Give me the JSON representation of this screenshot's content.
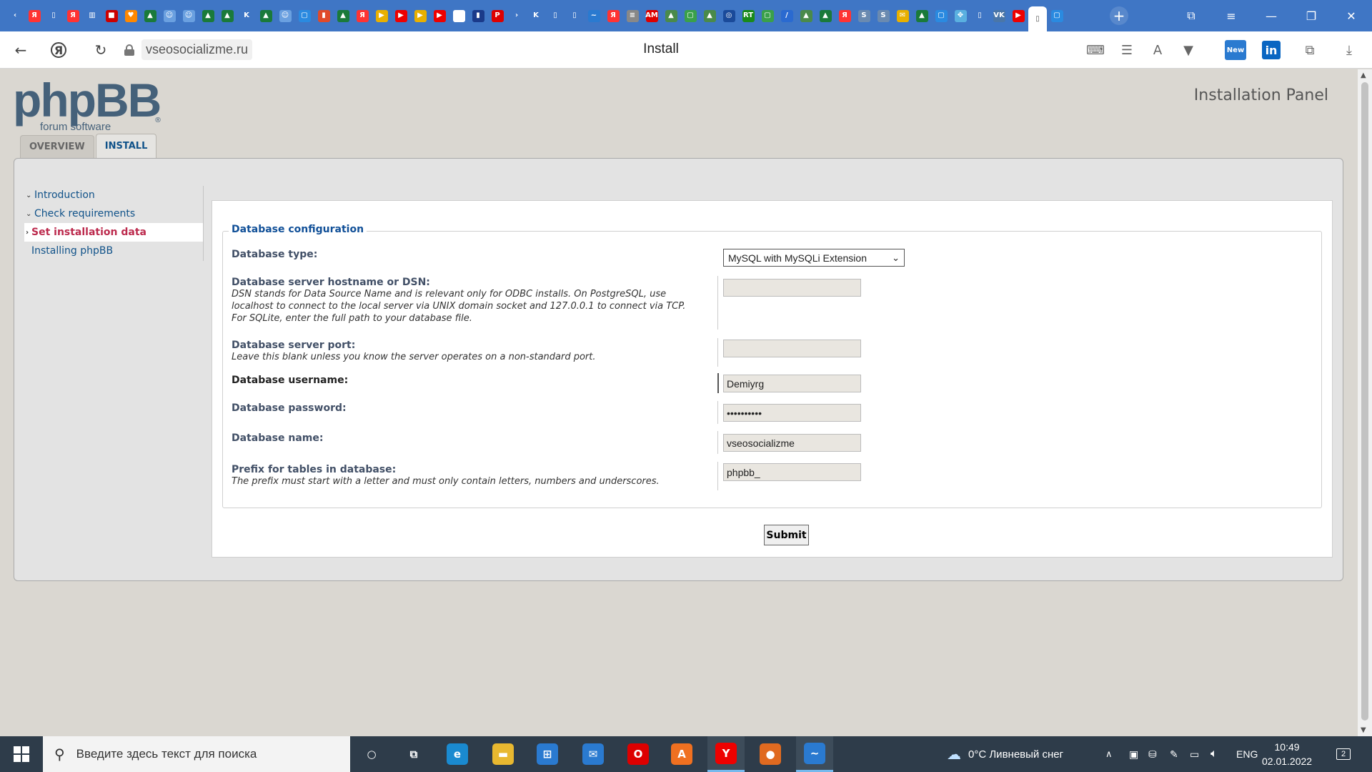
{
  "browser": {
    "tab_icons": [
      {
        "name": "tab-favicon-back",
        "glyph": "‹",
        "bg": "transparent"
      },
      {
        "name": "tab-favicon-yandex",
        "glyph": "Я",
        "bg": "#f33"
      },
      {
        "name": "tab-favicon-doc",
        "glyph": "▯",
        "bg": "transparent"
      },
      {
        "name": "tab-favicon-yandex",
        "glyph": "Я",
        "bg": "#f33"
      },
      {
        "name": "tab-favicon-chart",
        "glyph": "▥",
        "bg": "transparent"
      },
      {
        "name": "tab-favicon-bookmark",
        "glyph": "■",
        "bg": "#c00"
      },
      {
        "name": "tab-favicon-heart",
        "glyph": "♥",
        "bg": "#f80"
      },
      {
        "name": "tab-favicon-green",
        "glyph": "▲",
        "bg": "#1a7a3a"
      },
      {
        "name": "tab-favicon-people",
        "glyph": "☺",
        "bg": "#6aa0e0"
      },
      {
        "name": "tab-favicon-people",
        "glyph": "☺",
        "bg": "#6aa0e0"
      },
      {
        "name": "tab-favicon-green",
        "glyph": "▲",
        "bg": "#1a7a3a"
      },
      {
        "name": "tab-favicon-green",
        "glyph": "▲",
        "bg": "#1a7a3a"
      },
      {
        "name": "tab-favicon-k",
        "glyph": "K",
        "bg": "transparent"
      },
      {
        "name": "tab-favicon-green",
        "glyph": "▲",
        "bg": "#1a7a3a"
      },
      {
        "name": "tab-favicon-people",
        "glyph": "☺",
        "bg": "#6aa0e0"
      },
      {
        "name": "tab-favicon-chat",
        "glyph": "▢",
        "bg": "#2a8ae0"
      },
      {
        "name": "tab-favicon-bars",
        "glyph": "▮",
        "bg": "#e04a2a"
      },
      {
        "name": "tab-favicon-green",
        "glyph": "▲",
        "bg": "#1a7a3a"
      },
      {
        "name": "tab-favicon-yandex",
        "glyph": "Я",
        "bg": "#f33"
      },
      {
        "name": "tab-favicon-play",
        "glyph": "▶",
        "bg": "#e8b000"
      },
      {
        "name": "tab-favicon-youtube",
        "glyph": "▶",
        "bg": "#e00"
      },
      {
        "name": "tab-favicon-play",
        "glyph": "▶",
        "bg": "#e8b000"
      },
      {
        "name": "tab-favicon-youtube",
        "glyph": "▶",
        "bg": "#e00"
      },
      {
        "name": "tab-favicon-wiki",
        "glyph": "W",
        "bg": "#fff"
      },
      {
        "name": "tab-favicon-book",
        "glyph": "▮",
        "bg": "#1a3a8a"
      },
      {
        "name": "tab-favicon-pdf",
        "glyph": "P",
        "bg": "#d00"
      },
      {
        "name": "tab-favicon-arrow",
        "glyph": "›",
        "bg": "transparent"
      },
      {
        "name": "tab-favicon-k",
        "glyph": "K",
        "bg": "transparent"
      },
      {
        "name": "tab-favicon-doc",
        "glyph": "▯",
        "bg": "transparent"
      },
      {
        "name": "tab-favicon-doc",
        "glyph": "▯",
        "bg": "transparent"
      },
      {
        "name": "tab-favicon-wave",
        "glyph": "~",
        "bg": "#2a7ad0"
      },
      {
        "name": "tab-favicon-yandex",
        "glyph": "Я",
        "bg": "#f33"
      },
      {
        "name": "tab-favicon-stripes",
        "glyph": "≡",
        "bg": "#888"
      },
      {
        "name": "tab-favicon-am",
        "glyph": "AM",
        "bg": "#d00"
      },
      {
        "name": "tab-favicon-graph",
        "glyph": "▲",
        "bg": "#4a8a4a"
      },
      {
        "name": "tab-favicon-chat",
        "glyph": "▢",
        "bg": "#3aa04a"
      },
      {
        "name": "tab-favicon-graph",
        "glyph": "▲",
        "bg": "#4a8a4a"
      },
      {
        "name": "tab-favicon-globe",
        "glyph": "◎",
        "bg": "#1a4a9a"
      },
      {
        "name": "tab-favicon-rt",
        "glyph": "RT",
        "bg": "#1a8a1a"
      },
      {
        "name": "tab-favicon-chat",
        "glyph": "▢",
        "bg": "#3aa04a"
      },
      {
        "name": "tab-favicon-slash",
        "glyph": "/",
        "bg": "#2a6ad0"
      },
      {
        "name": "tab-favicon-graph",
        "glyph": "▲",
        "bg": "#4a8a4a"
      },
      {
        "name": "tab-favicon-green",
        "glyph": "▲",
        "bg": "#1a7a3a"
      },
      {
        "name": "tab-favicon-yandex",
        "glyph": "Я",
        "bg": "#f33"
      },
      {
        "name": "tab-favicon-s",
        "glyph": "S",
        "bg": "#6a8ab0"
      },
      {
        "name": "tab-favicon-s",
        "glyph": "S",
        "bg": "#6a8ab0"
      },
      {
        "name": "tab-favicon-mail",
        "glyph": "✉",
        "bg": "#e8b000"
      },
      {
        "name": "tab-favicon-green",
        "glyph": "▲",
        "bg": "#1a7a3a"
      },
      {
        "name": "tab-favicon-chat",
        "glyph": "▢",
        "bg": "#2a8ae0"
      },
      {
        "name": "tab-favicon-dots",
        "glyph": "✥",
        "bg": "#5ab0e0"
      },
      {
        "name": "tab-favicon-doc",
        "glyph": "▯",
        "bg": "transparent"
      },
      {
        "name": "tab-favicon-vk",
        "glyph": "VK",
        "bg": "#4a76a8"
      },
      {
        "name": "tab-favicon-youtube",
        "glyph": "▶",
        "bg": "#e00"
      },
      {
        "name": "tab-favicon-doc-active",
        "glyph": "▯",
        "bg": "transparent",
        "active": true
      },
      {
        "name": "tab-favicon-chat",
        "glyph": "▢",
        "bg": "#2a8ae0"
      }
    ],
    "domain": "vseosocializme.ru",
    "page_title": "Install"
  },
  "header": {
    "logo_main": "phpBB",
    "logo_sub": "forum software",
    "logo_reg": "®",
    "panel_title": "Installation Panel"
  },
  "tabs": [
    {
      "label": "OVERVIEW",
      "active": false
    },
    {
      "label": "INSTALL",
      "active": true
    }
  ],
  "menu": {
    "items": [
      {
        "label": "Introduction",
        "arrow": "⌄",
        "state": "done"
      },
      {
        "label": "Check requirements",
        "arrow": "⌄",
        "state": "done"
      },
      {
        "label": "Set installation data",
        "arrow": "›",
        "state": "active"
      },
      {
        "label": "Installing phpBB",
        "arrow": "",
        "state": "pending"
      }
    ]
  },
  "form": {
    "legend": "Database configuration",
    "db_type": {
      "label": "Database type:",
      "selected": "MySQL with MySQLi Extension"
    },
    "db_host": {
      "label": "Database server hostname or DSN:",
      "desc": "DSN stands for Data Source Name and is relevant only for ODBC installs. On PostgreSQL, use localhost to connect to the local server via UNIX domain socket and 127.0.0.1 to connect via TCP. For SQLite, enter the full path to your database file.",
      "value": ""
    },
    "db_port": {
      "label": "Database server port:",
      "desc": "Leave this blank unless you know the server operates on a non-standard port.",
      "value": ""
    },
    "db_user": {
      "label": "Database username:",
      "value": "Demiyrg"
    },
    "db_pass": {
      "label": "Database password:",
      "value": "••••••••••"
    },
    "db_name": {
      "label": "Database name:",
      "value": "vseosocializme"
    },
    "db_prefix": {
      "label": "Prefix for tables in database:",
      "desc": "The prefix must start with a letter and must only contain letters, numbers and underscores.",
      "value": "phpbb_"
    },
    "submit_label": "Submit"
  },
  "taskbar": {
    "search_placeholder": "Введите здесь текст для поиска",
    "apps": [
      {
        "name": "cortana-icon",
        "glyph": "○",
        "bg": "transparent"
      },
      {
        "name": "task-view-icon",
        "glyph": "⧉",
        "bg": "transparent"
      },
      {
        "name": "edge-icon",
        "glyph": "e",
        "bg": "#1a8ad0"
      },
      {
        "name": "explorer-icon",
        "glyph": "▬",
        "bg": "#e8b830"
      },
      {
        "name": "store-icon",
        "glyph": "⊞",
        "bg": "#2a7ad0"
      },
      {
        "name": "mail-icon",
        "glyph": "✉",
        "bg": "#2a7ad0"
      },
      {
        "name": "opera-icon",
        "glyph": "O",
        "bg": "#d00"
      },
      {
        "name": "avast-icon",
        "glyph": "A",
        "bg": "#f07020"
      },
      {
        "name": "yandex-browser-icon",
        "glyph": "Y",
        "bg": "#e00"
      },
      {
        "name": "firefox-icon",
        "glyph": "●",
        "bg": "#e06a20"
      },
      {
        "name": "app-wave-icon",
        "glyph": "~",
        "bg": "#2a7ad0"
      }
    ],
    "weather": "0°C  Ливневый снег",
    "lang": "ENG",
    "time": "10:49",
    "date": "02.01.2022",
    "notifications": "2"
  }
}
